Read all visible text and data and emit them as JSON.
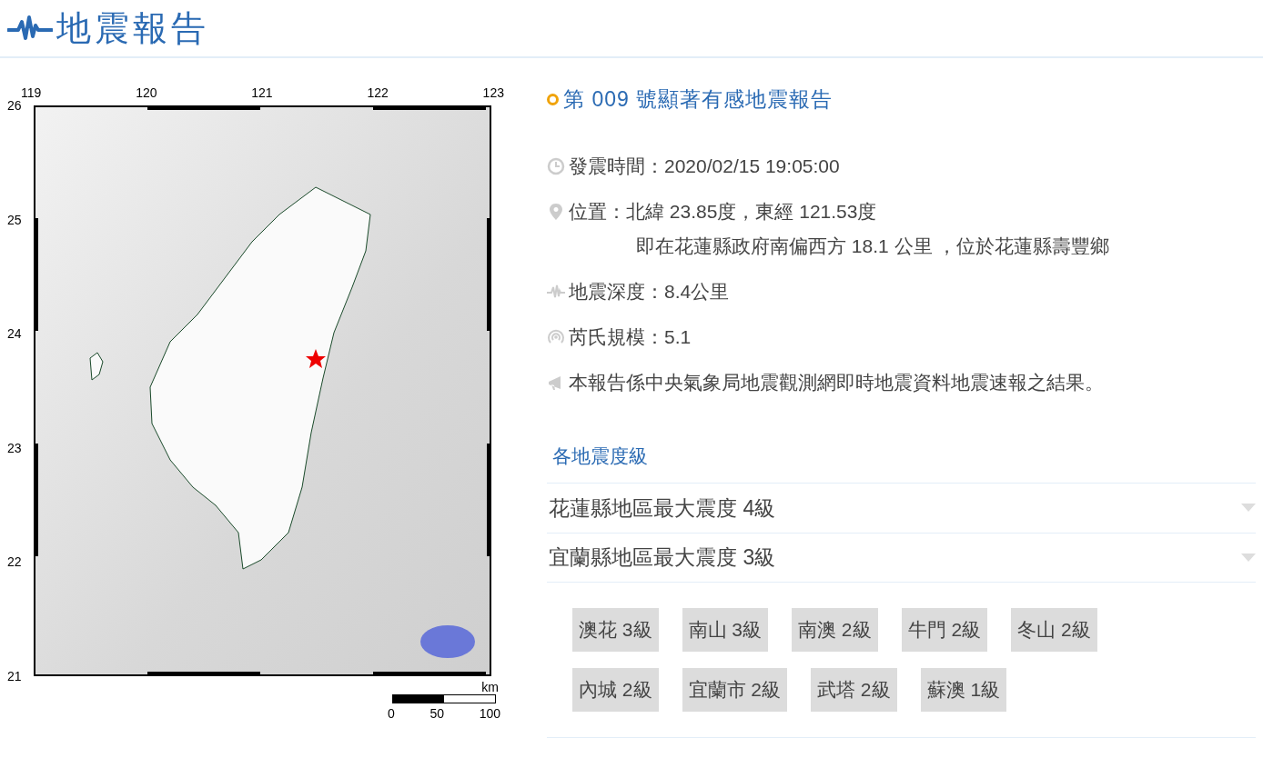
{
  "header": {
    "title": "地震報告"
  },
  "map": {
    "lon_ticks": [
      "119",
      "120",
      "121",
      "122",
      "123"
    ],
    "lat_ticks": [
      "26",
      "25",
      "24",
      "23",
      "22",
      "21"
    ],
    "scale": {
      "unit": "km",
      "labels": [
        "0",
        "50",
        "100"
      ]
    }
  },
  "report": {
    "title": "第 009 號顯著有感地震報告",
    "info": [
      {
        "kind": "time",
        "text": "發震時間：2020/02/15 19:05:00"
      },
      {
        "kind": "location",
        "text": "位置：北緯 23.85度，東經 121.53度",
        "detail": "即在花蓮縣政府南偏西方 18.1 公里 ，位於花蓮縣壽豐鄉"
      },
      {
        "kind": "depth",
        "text": "地震深度：8.4公里"
      },
      {
        "kind": "magnitude",
        "text": "芮氏規模：5.1"
      },
      {
        "kind": "note",
        "text": "本報告係中央氣象局地震觀測網即時地震資料地震速報之結果。"
      }
    ]
  },
  "intensity": {
    "heading": "各地震度級",
    "regions": [
      {
        "label": "花蓮縣地區最大震度 4級",
        "expanded": false
      },
      {
        "label": "宜蘭縣地區最大震度 3級",
        "expanded": true,
        "stations": [
          "澳花 3級",
          "南山 3級",
          "南澳 2級",
          "牛門 2級",
          "冬山 2級",
          "內城 2級",
          "宜蘭市 2級",
          "武塔 2級",
          "蘇澳 1級"
        ]
      }
    ]
  }
}
